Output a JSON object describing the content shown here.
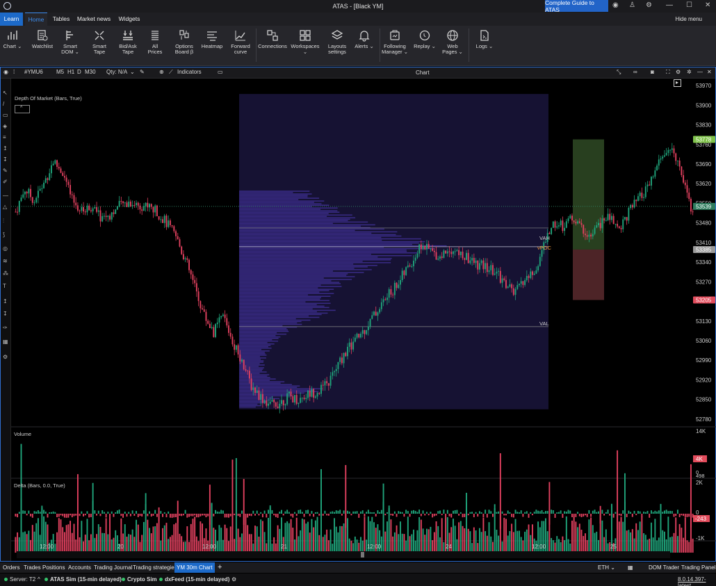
{
  "window": {
    "title": "ATAS - [Black YM]",
    "guide_button": "Complete Guide to ATAS"
  },
  "ribbon_tabs": [
    "Learn",
    "Home",
    "Tables",
    "Market news",
    "Widgets"
  ],
  "hide_menu": "Hide menu",
  "ribbon": [
    {
      "label": "Chart ⌄",
      "icon": "bar-chart-icon"
    },
    {
      "label": "Watchlist",
      "icon": "watchlist-icon"
    },
    {
      "label": "Smart\nDOM ⌄",
      "icon": "smart-dom-icon"
    },
    {
      "label": "Smart\nTape",
      "icon": "smart-tape-icon"
    },
    {
      "label": "Bid/Ask\nTape",
      "icon": "bid-ask-tape-icon"
    },
    {
      "label": "All\nPrices",
      "icon": "all-prices-icon"
    },
    {
      "label": "Options\nBoard β",
      "icon": "options-board-icon"
    },
    {
      "label": "Heatmap",
      "icon": "heatmap-icon"
    },
    {
      "label": "Forward\ncurve",
      "icon": "forward-curve-icon"
    },
    {
      "label": "Connections",
      "icon": "connections-icon"
    },
    {
      "label": "Workspaces ⌄",
      "icon": "workspaces-icon"
    },
    {
      "label": "Layouts\nsettings",
      "icon": "layouts-icon"
    },
    {
      "label": "Alerts ⌄",
      "icon": "bell-icon"
    },
    {
      "label": "Following\nManager ⌄",
      "icon": "following-manager-icon"
    },
    {
      "label": "Replay ⌄",
      "icon": "replay-icon"
    },
    {
      "label": "Web\nPages ⌄",
      "icon": "globe-icon"
    },
    {
      "label": "Logs ⌄",
      "icon": "logs-icon"
    }
  ],
  "chart_toolbar": {
    "symbol": "#YMU6",
    "timeframes": [
      "M5",
      "H1",
      "D",
      "M30"
    ],
    "qty": "Qty: N/A",
    "indicators": "Indicators",
    "title": "Chart"
  },
  "chart": {
    "indicator_label": "Depth Of Market (Bars, True)",
    "volume_label": "Volume",
    "delta_label": "Delta (Bars, 0.0, True)",
    "profile_labels": {
      "vah": "VAH",
      "vpoc": "vPOC",
      "val": "VAL"
    },
    "colors": {
      "up": "#1fa37a",
      "down": "#e0405e",
      "profile": "#3d2f8f",
      "profile_bg": "#161233"
    }
  },
  "chart_data": {
    "type": "candlestick",
    "price_axis": {
      "ticks": [
        53970,
        53900,
        53830,
        53760,
        53690,
        53620,
        53550,
        53480,
        53410,
        53340,
        53270,
        53200,
        53130,
        53060,
        52990,
        52920,
        52850,
        52780
      ],
      "ylim": [
        52755,
        53995
      ]
    },
    "price_tags": [
      {
        "value": 53778,
        "label": "53778",
        "color": "#7fc24a"
      },
      {
        "value": 53539,
        "label": "53539",
        "color": "#2e7d5e"
      },
      {
        "value": 53385,
        "label": "53385",
        "color": "#9a9a9a"
      },
      {
        "value": 53205,
        "label": "53205",
        "color": "#e24c5c"
      }
    ],
    "volume_axis": {
      "ticks": [
        "14K",
        "0"
      ],
      "current": "4K",
      "low_label": "498"
    },
    "delta_axis": {
      "ticks": [
        "2K",
        "0",
        "-1K"
      ],
      "current": "-243"
    },
    "time_axis": [
      "12:00",
      "20",
      "12:00",
      "21",
      "12:00",
      "24",
      "12:00",
      "25"
    ],
    "close_path": [
      53520,
      53600,
      53560,
      53620,
      53700,
      53660,
      53560,
      53520,
      53540,
      53500,
      53510,
      53540,
      53555,
      53545,
      53540,
      53520,
      53480,
      53430,
      53350,
      53250,
      53150,
      53090,
      53150,
      53060,
      52990,
      52900,
      52860,
      52830,
      52840,
      52860,
      52850,
      52870,
      52880,
      52900,
      52960,
      53020,
      53060,
      53100,
      53150,
      53200,
      53240,
      53290,
      53340,
      53400,
      53380,
      53360,
      53390,
      53370,
      53350,
      53330,
      53320,
      53300,
      53260,
      53230,
      53280,
      53300,
      53400,
      53480,
      53470,
      53500,
      53460,
      53430,
      53480,
      53500,
      53460,
      53520,
      53560,
      53600,
      53680,
      53740,
      53720,
      53620,
      53480
    ],
    "profile": {
      "vah": 53462,
      "vpoc": 53395,
      "val": 53110
    },
    "risk_reward": {
      "target": 53778,
      "entry": 53385,
      "stop": 53205
    }
  },
  "bottom_tabs": [
    "Orders",
    "Trades",
    "Positions",
    "Accounts",
    "Trading Journal",
    "Trading strategies",
    "YM 30m Chart",
    "+"
  ],
  "bottom_right": [
    "ETH ⌄",
    "DOM Trader",
    "Trading Panel"
  ],
  "status": {
    "server": "Server: T2",
    "connections": [
      "ATAS Sim (15-min delayed)",
      "Crypto Sim",
      "dxFeed (15-min delayed)"
    ],
    "version": "8.0.14.397-latest"
  }
}
